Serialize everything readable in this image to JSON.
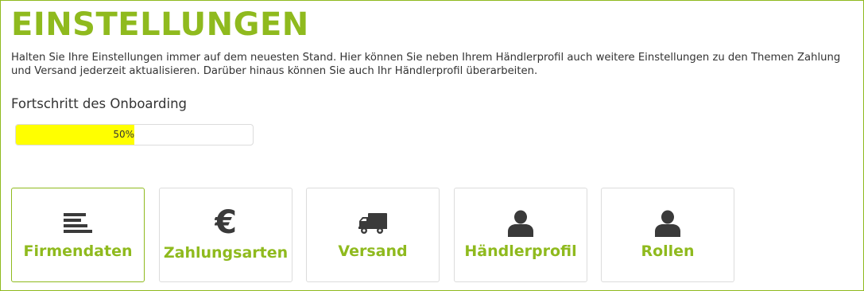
{
  "page": {
    "title": "EINSTELLUNGEN",
    "intro": "Halten Sie Ihre Einstellungen immer auf dem neuesten Stand. Hier können Sie neben Ihrem Händlerprofil auch weitere Einstellungen zu den Themen Zahlung und Versand jederzeit aktualisieren. Darüber hinaus können Sie auch Ihr Händlerprofil überarbeiten."
  },
  "onboarding": {
    "label": "Fortschritt des Onboarding",
    "progress_percent": 50,
    "progress_text": "50%",
    "fill_color": "#ffff00"
  },
  "tiles": [
    {
      "label": "Firmendaten",
      "icon": "list-lines-icon",
      "active": true
    },
    {
      "label": "Zahlungsarten",
      "icon": "euro-icon",
      "active": false
    },
    {
      "label": "Versand",
      "icon": "truck-icon",
      "active": false
    },
    {
      "label": "Händlerprofil",
      "icon": "user-icon",
      "active": false
    },
    {
      "label": "Rollen",
      "icon": "user-icon",
      "active": false
    }
  ],
  "colors": {
    "accent": "#8fba1e",
    "icon": "#3a3a3a",
    "border": "#dcdcdc"
  }
}
